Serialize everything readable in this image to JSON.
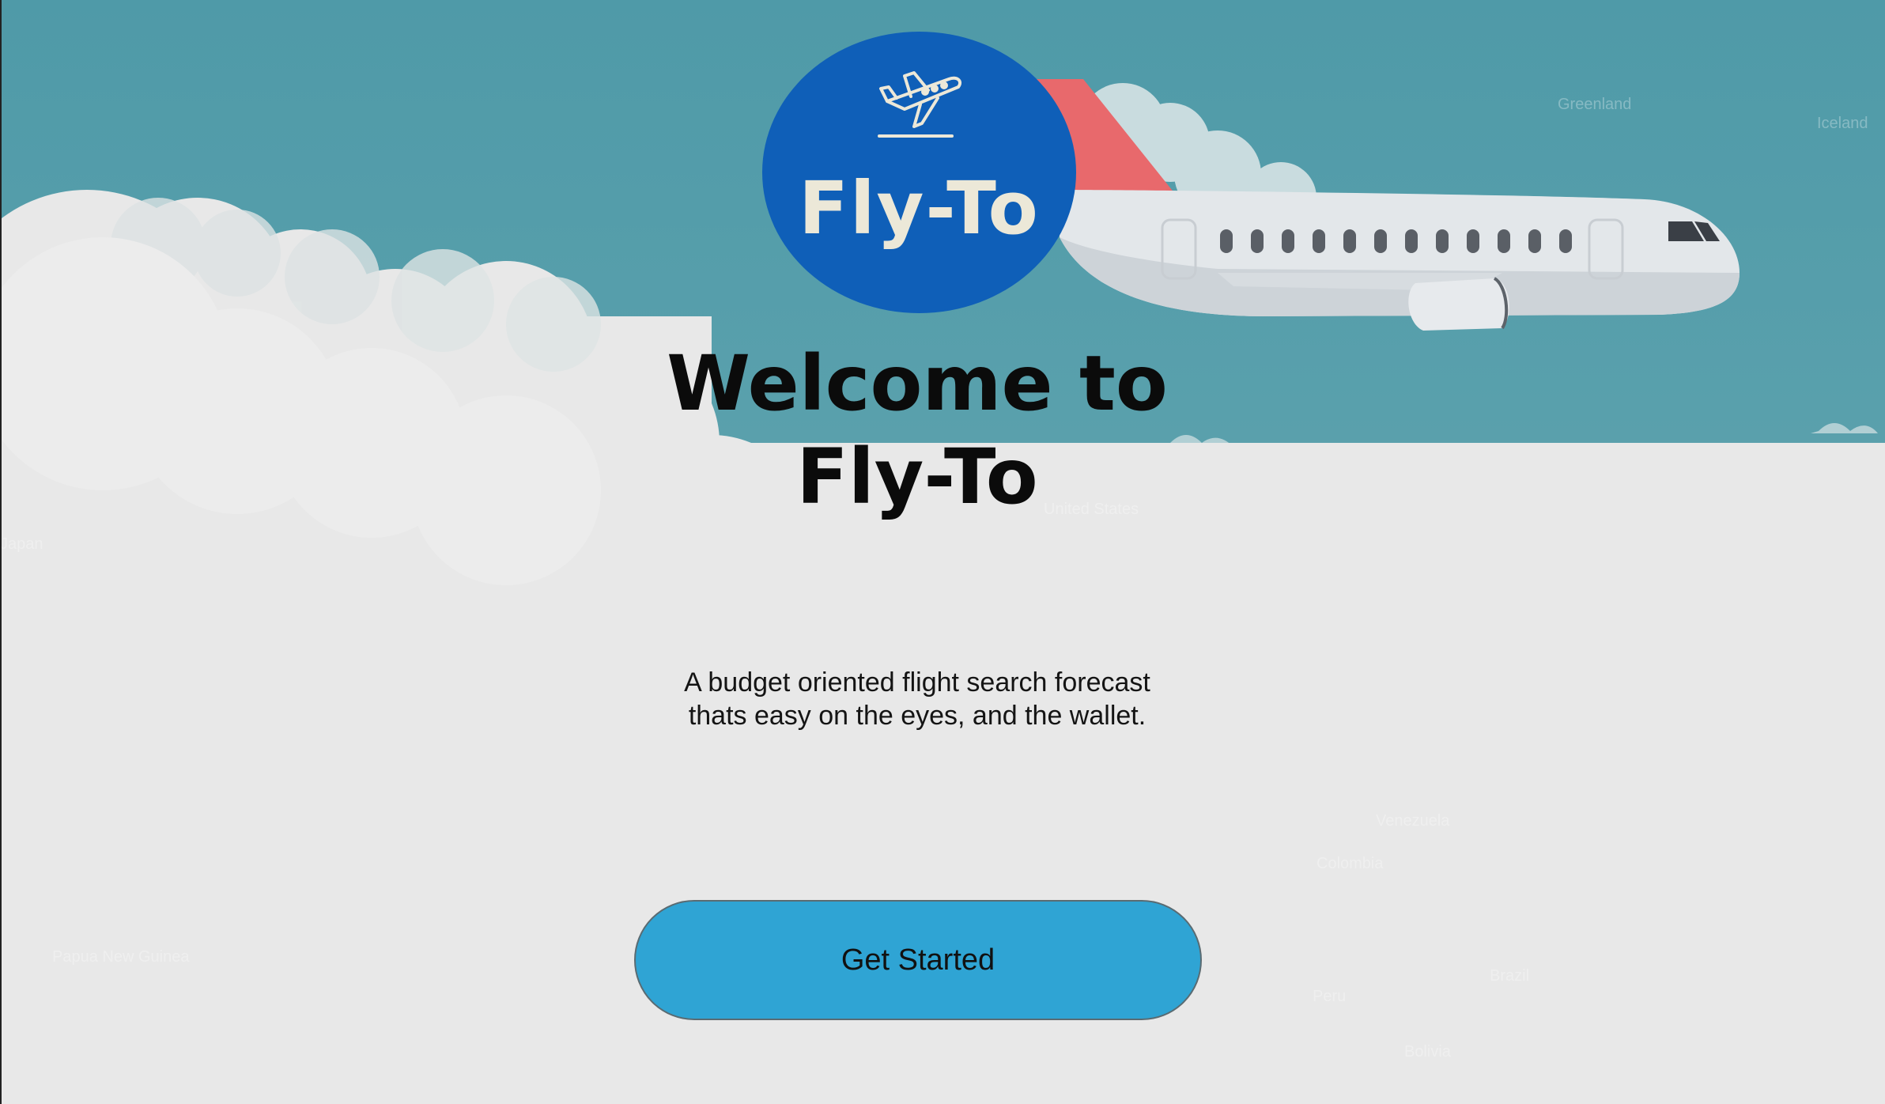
{
  "logo": {
    "text": "Fly-To",
    "icon": "airplane-icon",
    "background_color": "#0f5fb8"
  },
  "hero": {
    "heading_line1": "Welcome to",
    "heading_line2": "Fly-To",
    "tagline_line1": "A budget oriented flight search forecast",
    "tagline_line2": "thats easy on the eyes, and the wallet."
  },
  "cta": {
    "label": "Get Started",
    "color": "#2fa4d4"
  },
  "background": {
    "sky_color": "#5a9fac",
    "cloud_color": "#e8e8e8",
    "map_labels": {
      "greenland": "Greenland",
      "iceland": "Iceland",
      "united_states": "United States",
      "japan": "Japan",
      "papua": "Papua New Guinea",
      "colombia": "Colombia",
      "venezuela": "Venezuela",
      "peru": "Peru",
      "bolivia": "Bolivia",
      "brazil": "Brazil"
    }
  }
}
